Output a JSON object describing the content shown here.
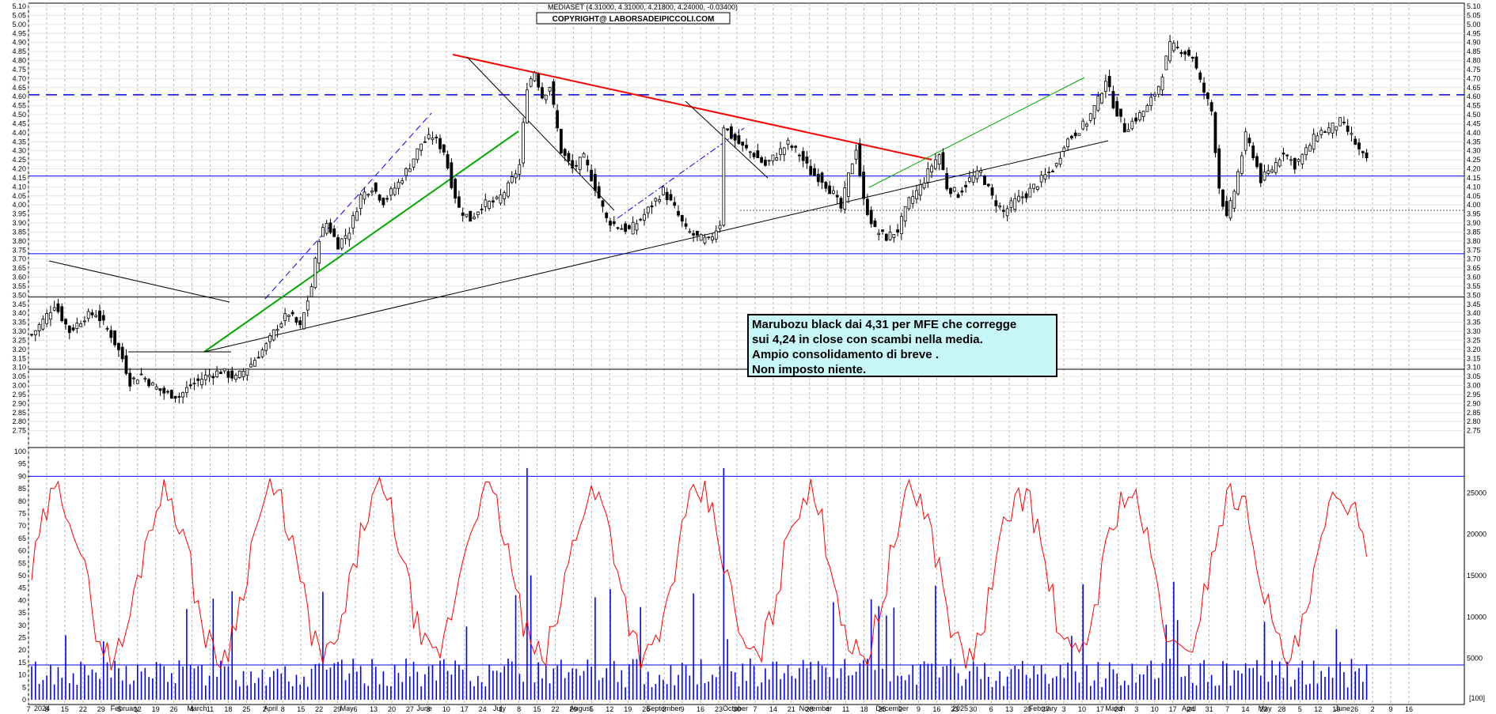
{
  "header": {
    "quote": "MEDIASET (4.31000, 4.31000, 4.21800, 4.24000, -0.03400)",
    "copyright": "COPYRIGHT@ LABORSADEIPICCOLI.COM"
  },
  "annotation": {
    "lines": [
      "Marubozu black dai 4,31 per MFE che corregge",
      "sui 4,24 in close con scambi nella media.",
      "Ampio consolidamento di breve .",
      "Non imposto niente."
    ]
  },
  "colors": {
    "candle": "#000000",
    "resistance_trend": "#ff0000",
    "support_trend": "#00aa00",
    "levels": "#0000ff",
    "oscillator": "#ff0000",
    "volume": "#0000ff"
  },
  "x_axis": {
    "ticks": [
      "7",
      "8",
      "15",
      "22",
      "29",
      "5",
      "12",
      "19",
      "26",
      "4",
      "11",
      "18",
      "25",
      "2",
      "8",
      "15",
      "22",
      "29",
      "6",
      "13",
      "20",
      "27",
      "3",
      "10",
      "17",
      "24",
      "1",
      "8",
      "15",
      "22",
      "29",
      "5",
      "12",
      "19",
      "26",
      "2",
      "9",
      "16",
      "23",
      "30",
      "7",
      "14",
      "21",
      "28",
      "4",
      "11",
      "18",
      "25",
      "2",
      "9",
      "16",
      "23",
      "30",
      "6",
      "13",
      "20",
      "27",
      "3",
      "10",
      "17",
      "24",
      "3",
      "10",
      "17",
      "24",
      "31",
      "7",
      "14",
      "22",
      "28",
      "5",
      "12",
      "19",
      "26",
      "2",
      "9",
      "16"
    ],
    "months": [
      "2024",
      "February",
      "March",
      "April",
      "May",
      "June",
      "July",
      "August",
      "September",
      "October",
      "November",
      "December",
      "2025",
      "February",
      "March",
      "April",
      "May",
      "June"
    ]
  },
  "chart_data": [
    {
      "type": "candlestick",
      "title": "MEDIASET (4.31000, 4.31000, 4.21800, 4.24000, -0.03400)",
      "period": "January 2024 - June 2025 (daily)",
      "last_bar": {
        "open": 4.31,
        "high": 4.31,
        "low": 4.218,
        "close": 4.24,
        "change": -0.034
      },
      "ylim": [
        2.7,
        5.1
      ],
      "y_ticks": [
        "5.10",
        "5.05",
        "5.00",
        "4.95",
        "4.90",
        "4.85",
        "4.80",
        "4.75",
        "4.70",
        "4.65",
        "4.60",
        "4.55",
        "4.50",
        "4.45",
        "4.40",
        "4.35",
        "4.30",
        "4.25",
        "4.20",
        "4.15",
        "4.10",
        "4.05",
        "4.00",
        "3.95",
        "3.90",
        "3.85",
        "3.80",
        "3.75",
        "3.70",
        "3.65",
        "3.60",
        "3.55",
        "3.50",
        "3.45",
        "3.40",
        "3.35",
        "3.30",
        "3.25",
        "3.20",
        "3.15",
        "3.10",
        "3.05",
        "3.00",
        "2.95",
        "2.90",
        "2.85",
        "2.80",
        "2.75"
      ],
      "close_path": [
        [
          0,
          3.28
        ],
        [
          6,
          3.36
        ],
        [
          12,
          3.45
        ],
        [
          20,
          3.3
        ],
        [
          28,
          3.38
        ],
        [
          34,
          3.4
        ],
        [
          42,
          3.28
        ],
        [
          48,
          3.15
        ],
        [
          52,
          3.02
        ],
        [
          58,
          3.06
        ],
        [
          64,
          3.0
        ],
        [
          70,
          2.96
        ],
        [
          78,
          2.94
        ],
        [
          84,
          3.0
        ],
        [
          92,
          3.05
        ],
        [
          100,
          3.08
        ],
        [
          108,
          3.04
        ],
        [
          116,
          3.12
        ],
        [
          124,
          3.22
        ],
        [
          130,
          3.33
        ],
        [
          136,
          3.4
        ],
        [
          142,
          3.32
        ],
        [
          148,
          3.55
        ],
        [
          152,
          3.82
        ],
        [
          156,
          3.9
        ],
        [
          162,
          3.78
        ],
        [
          168,
          3.86
        ],
        [
          174,
          4.05
        ],
        [
          180,
          4.1
        ],
        [
          186,
          4.02
        ],
        [
          194,
          4.12
        ],
        [
          200,
          4.22
        ],
        [
          206,
          4.34
        ],
        [
          212,
          4.38
        ],
        [
          218,
          4.3
        ],
        [
          222,
          4.12
        ],
        [
          226,
          3.98
        ],
        [
          232,
          3.92
        ],
        [
          238,
          4.0
        ],
        [
          246,
          4.02
        ],
        [
          252,
          4.1
        ],
        [
          258,
          4.22
        ],
        [
          262,
          4.66
        ],
        [
          266,
          4.74
        ],
        [
          270,
          4.6
        ],
        [
          274,
          4.66
        ],
        [
          280,
          4.3
        ],
        [
          286,
          4.2
        ],
        [
          292,
          4.26
        ],
        [
          298,
          4.1
        ],
        [
          304,
          3.92
        ],
        [
          310,
          3.88
        ],
        [
          316,
          3.86
        ],
        [
          322,
          3.92
        ],
        [
          328,
          4.0
        ],
        [
          334,
          4.08
        ],
        [
          340,
          3.98
        ],
        [
          346,
          3.86
        ],
        [
          352,
          3.82
        ],
        [
          358,
          3.8
        ],
        [
          364,
          3.9
        ],
        [
          366,
          4.44
        ],
        [
          370,
          4.38
        ],
        [
          376,
          4.32
        ],
        [
          382,
          4.28
        ],
        [
          388,
          4.22
        ],
        [
          394,
          4.28
        ],
        [
          400,
          4.34
        ],
        [
          406,
          4.28
        ],
        [
          412,
          4.18
        ],
        [
          418,
          4.14
        ],
        [
          424,
          4.06
        ],
        [
          428,
          3.98
        ],
        [
          432,
          4.16
        ],
        [
          436,
          4.32
        ],
        [
          440,
          4.02
        ],
        [
          446,
          3.86
        ],
        [
          452,
          3.82
        ],
        [
          458,
          3.86
        ],
        [
          464,
          4.02
        ],
        [
          470,
          4.1
        ],
        [
          476,
          4.22
        ],
        [
          480,
          4.28
        ],
        [
          484,
          4.1
        ],
        [
          490,
          4.06
        ],
        [
          496,
          4.14
        ],
        [
          502,
          4.18
        ],
        [
          508,
          4.04
        ],
        [
          514,
          3.96
        ],
        [
          520,
          4.02
        ],
        [
          526,
          4.06
        ],
        [
          532,
          4.12
        ],
        [
          538,
          4.18
        ],
        [
          542,
          4.22
        ],
        [
          546,
          4.34
        ],
        [
          552,
          4.4
        ],
        [
          558,
          4.46
        ],
        [
          564,
          4.58
        ],
        [
          568,
          4.7
        ],
        [
          572,
          4.56
        ],
        [
          578,
          4.42
        ],
        [
          584,
          4.48
        ],
        [
          590,
          4.54
        ],
        [
          596,
          4.66
        ],
        [
          602,
          4.88
        ],
        [
          608,
          4.86
        ],
        [
          614,
          4.82
        ],
        [
          618,
          4.68
        ],
        [
          624,
          4.52
        ],
        [
          628,
          4.1
        ],
        [
          632,
          3.92
        ],
        [
          636,
          4.08
        ],
        [
          642,
          4.38
        ],
        [
          646,
          4.28
        ],
        [
          650,
          4.14
        ],
        [
          656,
          4.2
        ],
        [
          662,
          4.3
        ],
        [
          668,
          4.22
        ],
        [
          674,
          4.3
        ],
        [
          680,
          4.4
        ],
        [
          686,
          4.42
        ],
        [
          692,
          4.46
        ],
        [
          698,
          4.38
        ],
        [
          702,
          4.3
        ],
        [
          706,
          4.24
        ]
      ],
      "levels": [
        {
          "name": "resistance",
          "value": 4.61,
          "style": "dashed"
        },
        {
          "name": "support-1",
          "value": 4.16,
          "style": "solid"
        },
        {
          "name": "support-2",
          "value": 3.73,
          "style": "solid"
        },
        {
          "name": "level-3.49",
          "value": 3.49,
          "style": "solid"
        },
        {
          "name": "level-3.09",
          "value": 3.09,
          "style": "solid"
        },
        {
          "name": "dotted-3.97",
          "value": 3.97,
          "style": "dotted"
        }
      ]
    },
    {
      "type": "line",
      "name": "oscillator",
      "ylim": [
        0,
        100
      ],
      "y_ticks": [
        "100",
        "95",
        "90",
        "85",
        "80",
        "75",
        "70",
        "65",
        "60",
        "55",
        "50",
        "45",
        "40",
        "35",
        "30",
        "25",
        "20",
        "15",
        "10",
        "5",
        "0"
      ],
      "levels": [
        90,
        14
      ]
    },
    {
      "type": "bar",
      "name": "volume",
      "right_ticks": [
        "25000",
        "20000",
        "15000",
        "10000",
        "5000"
      ],
      "ylim": [
        0,
        30000
      ]
    }
  ],
  "zoom_label": "[100]"
}
